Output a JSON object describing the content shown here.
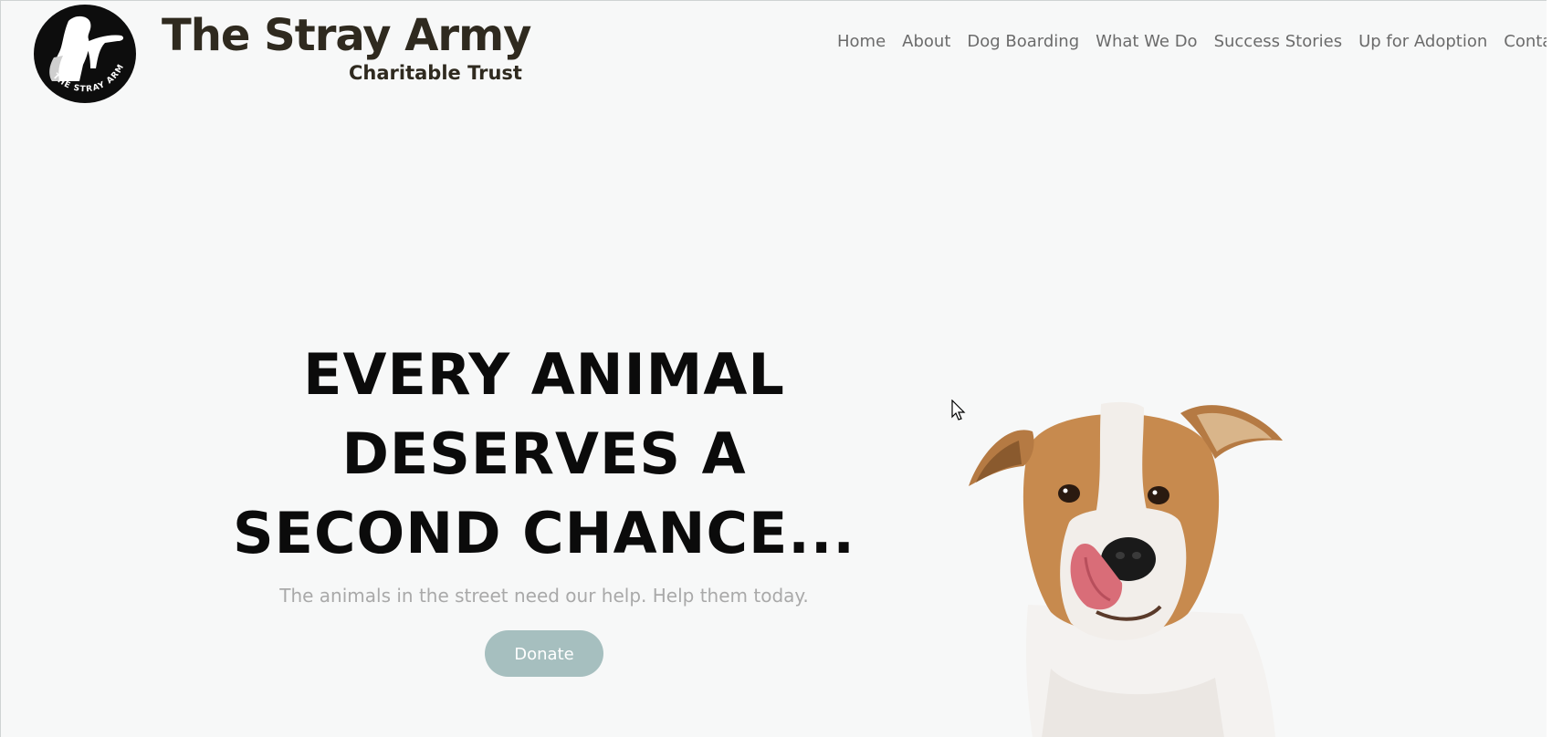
{
  "header": {
    "brand_title": "The Stray Army",
    "brand_subtitle": "Charitable Trust",
    "logo_ring_text": "THE STRAY ARMY",
    "nav": [
      {
        "label": "Home"
      },
      {
        "label": "About"
      },
      {
        "label": "Dog Boarding"
      },
      {
        "label": "What We Do"
      },
      {
        "label": "Success Stories"
      },
      {
        "label": "Up for Adoption"
      },
      {
        "label": "Contact Us"
      }
    ]
  },
  "hero": {
    "headline_line1": "EVERY ANIMAL",
    "headline_line2": "DESERVES A",
    "headline_line3": "SECOND CHANCE...",
    "subtitle": "The animals in the street need our help. Help them today.",
    "donate_label": "Donate"
  },
  "colors": {
    "background": "#f7f8f8",
    "brand_text": "#2f2a1f",
    "nav_text": "#6b6b6b",
    "headline": "#0b0b0b",
    "subtitle": "#a9a9a9",
    "donate_button": "#a6bfbf"
  },
  "icons": {
    "logo": "stray-army-logo",
    "cursor": "mouse-cursor-icon"
  }
}
